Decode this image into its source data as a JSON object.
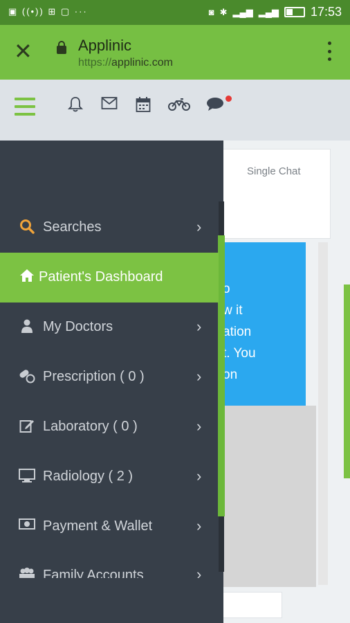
{
  "status_bar": {
    "time": "17:53"
  },
  "browser": {
    "title": "Applinic",
    "url_protocol": "https://",
    "url_domain": "applinic.com"
  },
  "page": {
    "single_chat_label": "Single Chat",
    "blue_panel_lines": [
      "o",
      "w it",
      "ation",
      "t. You",
      "on"
    ]
  },
  "drawer": {
    "items": [
      {
        "label": "Searches",
        "icon": "search-icon",
        "has_arrow": true
      },
      {
        "label": "Patient's Dashboard",
        "icon": "home-icon",
        "active": true
      },
      {
        "label": "My Doctors",
        "icon": "doctor-icon",
        "has_arrow": true
      },
      {
        "label": "Prescription ( 0 )",
        "icon": "pills-icon",
        "has_arrow": true
      },
      {
        "label": "Laboratory ( 0 )",
        "icon": "edit-icon",
        "has_arrow": true
      },
      {
        "label": "Radiology ( 2 )",
        "icon": "monitor-icon",
        "has_arrow": true
      },
      {
        "label": "Payment & Wallet",
        "icon": "money-icon",
        "has_arrow": true
      },
      {
        "label": "Family Accounts",
        "icon": "users-icon",
        "has_arrow": true,
        "partially_visible": true
      }
    ]
  },
  "colors": {
    "accent_green": "#7cc243",
    "drawer_bg": "#373f49",
    "blue_panel": "#2ba8ef",
    "url_bar": "#76bf43"
  }
}
